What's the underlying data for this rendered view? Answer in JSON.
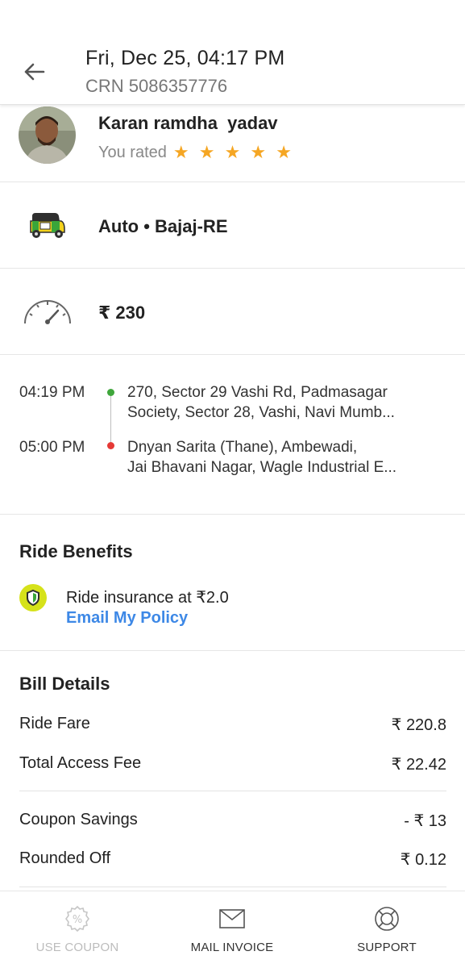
{
  "header": {
    "title": "Fri, Dec 25, 04:17 PM",
    "crn": "CRN 5086357776"
  },
  "driver": {
    "name": "Karan ramdha  yadav",
    "rated_label": "You rated",
    "stars": "★ ★ ★ ★ ★",
    "rating": 5
  },
  "vehicle": {
    "icon": "auto-rickshaw-icon",
    "label": "Auto • Bajaj-RE"
  },
  "fare": {
    "icon": "speedometer-icon",
    "amount": "₹ 230"
  },
  "route": {
    "pickup": {
      "time": "04:19 PM",
      "line1": "270, Sector 29 Vashi Rd, Padmasagar",
      "line2": "Society, Sector 28, Vashi, Navi Mumb..."
    },
    "drop": {
      "time": "05:00 PM",
      "line1": "Dnyan Sarita (Thane), Ambewadi,",
      "line2": "Jai Bhavani Nagar, Wagle Industrial E..."
    },
    "pickup_color": "#3fa63b",
    "drop_color": "#e53935"
  },
  "benefits": {
    "title": "Ride Benefits",
    "insurance_text": "Ride insurance at ₹2.0",
    "email_policy": "Email My Policy"
  },
  "bill": {
    "title": "Bill Details",
    "rows": [
      {
        "label": "Ride Fare",
        "value": "₹ 220.8"
      },
      {
        "label": "Total Access Fee",
        "value": "₹ 22.42"
      },
      {
        "label": "Coupon Savings",
        "value": "- ₹ 13"
      },
      {
        "label": "Rounded Off",
        "value": "₹ 0.12"
      }
    ]
  },
  "bottom_bar": {
    "coupon": "USE COUPON",
    "mail": "MAIL INVOICE",
    "support": "SUPPORT"
  },
  "colors": {
    "star": "#f5a623",
    "link": "#3d88e6",
    "shield_bg": "#d6e21a"
  }
}
